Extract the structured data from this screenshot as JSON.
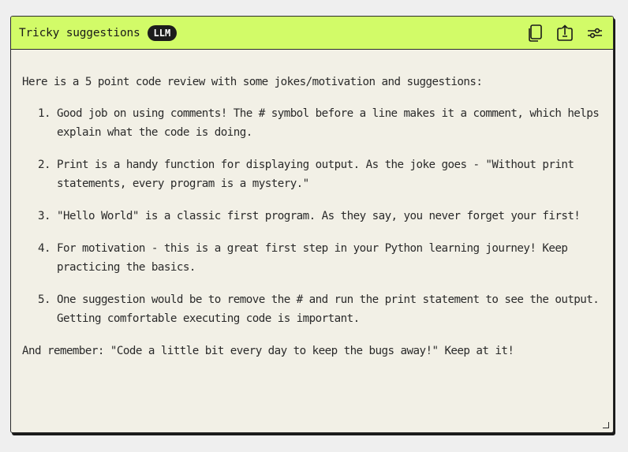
{
  "header": {
    "title": "Tricky suggestions",
    "badge": "LLM",
    "icons": [
      "copy-icon",
      "share-icon",
      "settings-sliders-icon"
    ]
  },
  "content": {
    "intro": "Here is a 5 point code review with some jokes/motivation and suggestions:",
    "items": [
      "Good job on using comments! The # symbol before a line makes it a comment, which helps explain what the code is doing.",
      "Print is a handy function for displaying output. As the joke goes - \"Without print statements, every program is a mystery.\"",
      "\"Hello World\" is a classic first program. As they say, you never forget your first!",
      "For motivation - this is a great first step in your Python learning journey! Keep practicing the basics.",
      "One suggestion would be to remove the # and run the print statement to see the output. Getting comfortable executing code is important."
    ],
    "outro": "And remember: \"Code a little bit every day to keep the bugs away!\" Keep at it!"
  },
  "colors": {
    "header_bg": "#d2fb68",
    "card_bg": "#f2f0e6",
    "badge_bg": "#1c1c1c",
    "border": "#2a2a2a"
  }
}
